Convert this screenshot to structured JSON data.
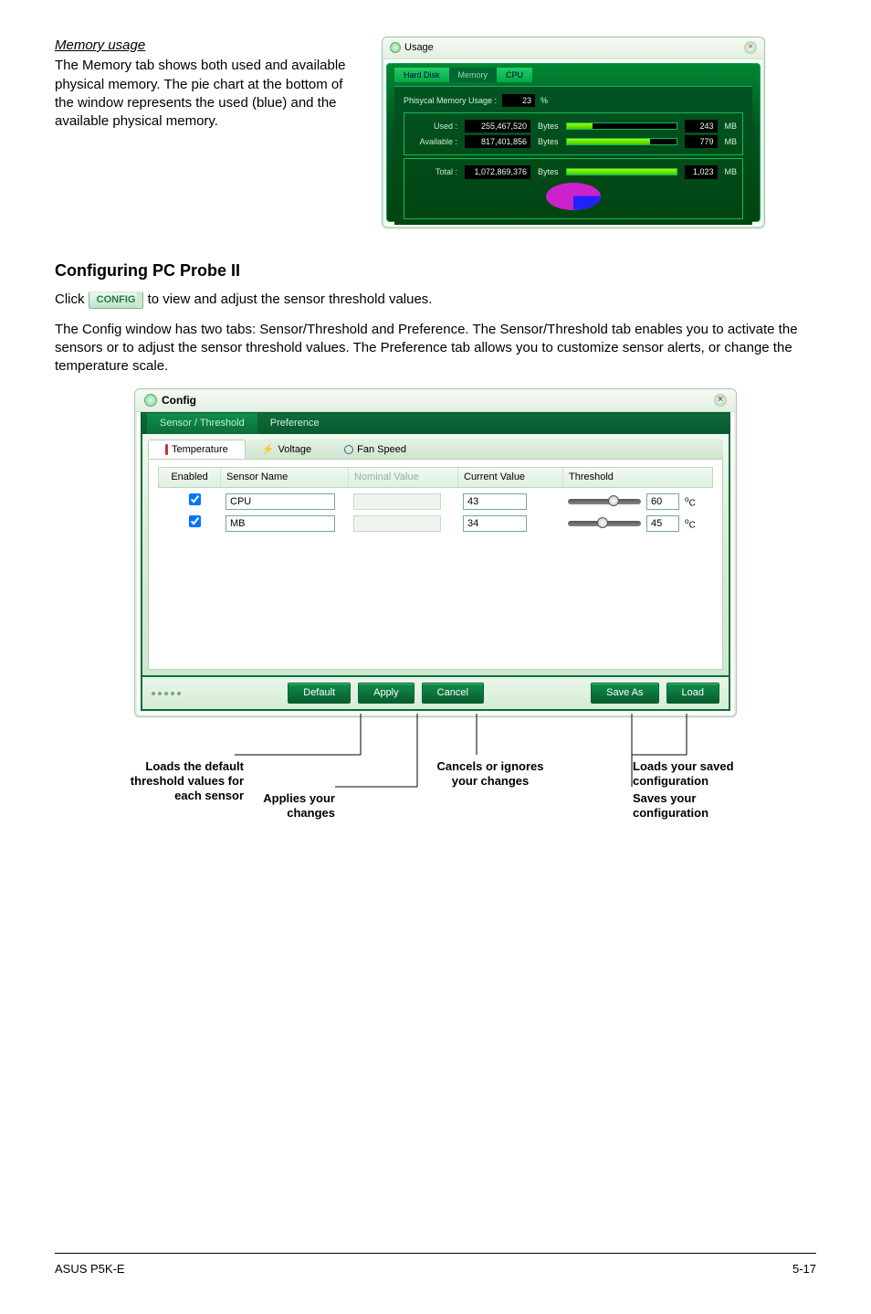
{
  "memory": {
    "heading": "Memory usage",
    "desc": "The Memory tab shows both used and available physical memory. The pie chart at the bottom of the window represents the used (blue) and the available physical memory.",
    "window_title": "Usage",
    "tabs": {
      "hard": "Hard Disk",
      "mem": "Memory",
      "cpu": "CPU"
    },
    "usage_label": "Phisycal Memory Usage :",
    "usage_pct": "23",
    "pct_suffix": "%",
    "rows": {
      "used": {
        "label": "Used :",
        "bytes": "255,467,520",
        "bytes_unit": "Bytes",
        "mb": "243",
        "mb_unit": "MB",
        "bar_pct": 24
      },
      "avail": {
        "label": "Available :",
        "bytes": "817,401,856",
        "bytes_unit": "Bytes",
        "mb": "779",
        "mb_unit": "MB",
        "bar_pct": 76
      },
      "total": {
        "label": "Total :",
        "bytes": "1,072,869,376",
        "bytes_unit": "Bytes",
        "mb": "1,023",
        "mb_unit": "MB",
        "bar_pct": 100
      }
    }
  },
  "section_title": "Configuring PC Probe II",
  "click_text_a": "Click ",
  "config_btn_label": "CONFIG",
  "click_text_b": " to view and adjust the sensor threshold values.",
  "para2": "The Config window has two tabs: Sensor/Threshold and Preference. The Sensor/Threshold tab enables you to activate the sensors or to adjust the sensor threshold values. The Preference tab allows you to customize sensor alerts, or change the temperature scale.",
  "config": {
    "title": "Config",
    "top_tabs": {
      "sensor": "Sensor / Threshold",
      "pref": "Preference"
    },
    "sub_tabs": {
      "temp": "Temperature",
      "volt": "Voltage",
      "fan": "Fan Speed"
    },
    "headers": {
      "enabled": "Enabled",
      "sensor": "Sensor Name",
      "nominal": "Nominal Value",
      "current": "Current Value",
      "threshold": "Threshold"
    },
    "unit_suffix_o": "o",
    "unit_suffix_c": "C",
    "rows": [
      {
        "enabled": true,
        "name": "CPU",
        "current": "43",
        "threshold": "60",
        "knob_pct": 55
      },
      {
        "enabled": true,
        "name": "MB",
        "current": "34",
        "threshold": "45",
        "knob_pct": 40
      }
    ],
    "buttons": {
      "default": "Default",
      "apply": "Apply",
      "cancel": "Cancel",
      "saveas": "Save As",
      "load": "Load"
    }
  },
  "callouts": {
    "default": "Loads the default threshold values for each sensor",
    "apply": "Applies your changes",
    "cancel": "Cancels or ignores your changes",
    "load": "Loads your saved configuration",
    "saveas": "Saves your configuration"
  },
  "footer": {
    "left": "ASUS P5K-E",
    "right": "5-17"
  }
}
